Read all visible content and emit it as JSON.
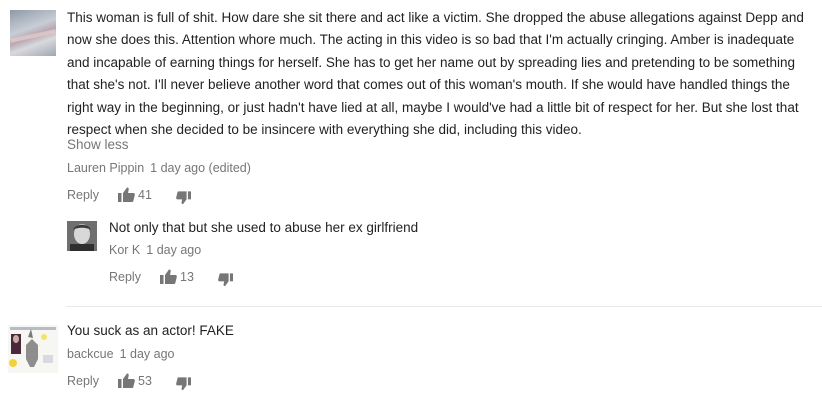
{
  "comments": [
    {
      "text": "This woman is full of shit. How dare she sit there and act like a victim. She dropped the abuse allegations against Depp and now she does this. Attention whore much. The acting in this video is so bad that I'm actually cringing. Amber is inadequate and incapable of earning things for herself. She has to get her name out by spreading lies and pretending to be something that she's not. I'll never believe another word that comes out of this woman's mouth. If she would have handled things the right way in the beginning, or just hadn't have lied at all, maybe I would've had a little bit of respect for her. But she lost that respect when she decided to be insincere with everything she did, including this video.",
      "show_less": "Show less",
      "author": "Lauren Pippin",
      "time": "1 day ago (edited)",
      "reply": "Reply",
      "likes": "41"
    },
    {
      "text": "Not only that but she used to abuse her ex girlfriend",
      "author": "Kor K",
      "time": "1 day ago",
      "reply": "Reply",
      "likes": "13"
    },
    {
      "text": "You suck as an actor! FAKE",
      "author": "backcue",
      "time": "1 day ago",
      "reply": "Reply",
      "likes": "53"
    }
  ],
  "icons": {
    "like": "thumbs-up-icon",
    "dislike": "thumbs-down-icon"
  },
  "colors": {
    "text": "#222222",
    "meta": "#767676"
  }
}
